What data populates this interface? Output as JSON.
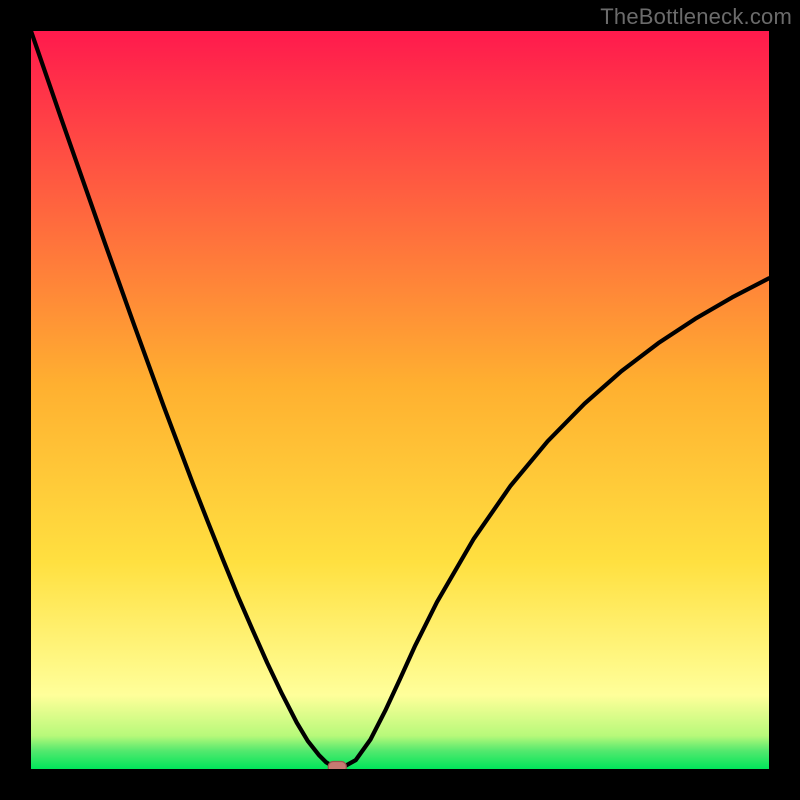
{
  "watermark": "TheBottleneck.com",
  "colors": {
    "frame_bg": "#000000",
    "grad_top": "#ff1a4d",
    "grad_mid": "#ffd830",
    "grad_low": "#ffff8a",
    "grad_band": "#77fb86",
    "grad_bottom": "#00e55a",
    "curve": "#000000",
    "marker_fill": "#c77a72",
    "marker_stroke": "#9c554e"
  },
  "chart_data": {
    "type": "line",
    "title": "",
    "xlabel": "",
    "ylabel": "",
    "xlim": [
      0,
      100
    ],
    "ylim": [
      0,
      100
    ],
    "x": [
      0,
      2,
      4,
      6,
      8,
      10,
      12,
      14,
      16,
      18,
      20,
      22,
      24,
      26,
      28,
      30,
      32,
      34,
      36,
      37.5,
      39,
      40,
      41,
      42,
      44,
      46,
      48,
      50,
      52,
      55,
      60,
      65,
      70,
      75,
      80,
      85,
      90,
      95,
      100
    ],
    "y": [
      100,
      94.2,
      88.4,
      82.7,
      77.0,
      71.3,
      65.7,
      60.1,
      54.6,
      49.1,
      43.8,
      38.5,
      33.4,
      28.4,
      23.5,
      18.9,
      14.4,
      10.2,
      6.3,
      3.8,
      1.9,
      0.9,
      0.3,
      0.1,
      1.2,
      4.0,
      7.9,
      12.2,
      16.6,
      22.6,
      31.2,
      38.4,
      44.4,
      49.5,
      53.9,
      57.7,
      61.0,
      63.9,
      66.5
    ],
    "marker": {
      "x": 41.5,
      "y": 0.2
    }
  }
}
